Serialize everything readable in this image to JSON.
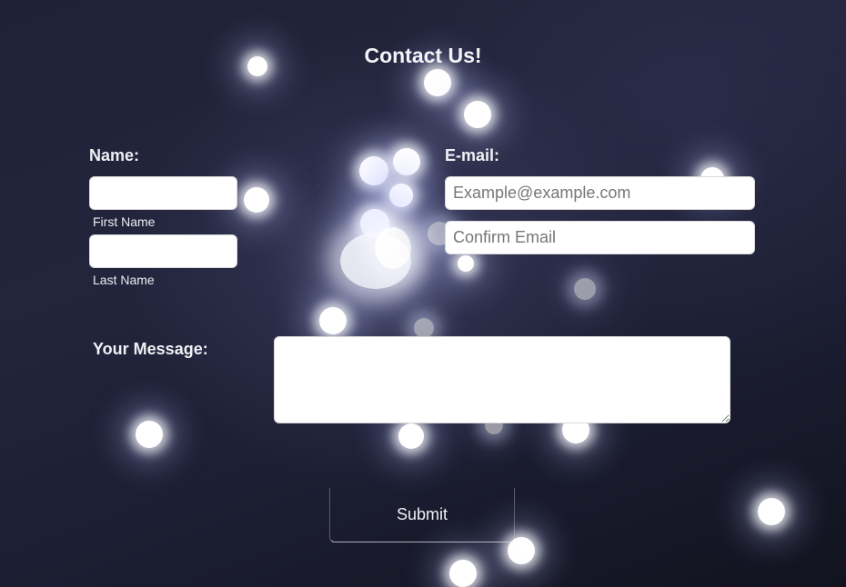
{
  "page": {
    "title": "Contact Us!"
  },
  "form": {
    "name_label": "Name:",
    "first_name_caption": "First Name",
    "last_name_caption": "Last Name",
    "first_name_value": "",
    "last_name_value": "",
    "email_label": "E-mail:",
    "email_placeholder": "Example@example.com",
    "confirm_email_placeholder": "Confirm Email",
    "message_label": "Your Message:",
    "message_value": "",
    "submit_label": "Submit"
  },
  "colors": {
    "background": "#1f2136",
    "text": "#f2f2f6",
    "field_background": "#ffffff",
    "bokeh": "#ffffff"
  }
}
